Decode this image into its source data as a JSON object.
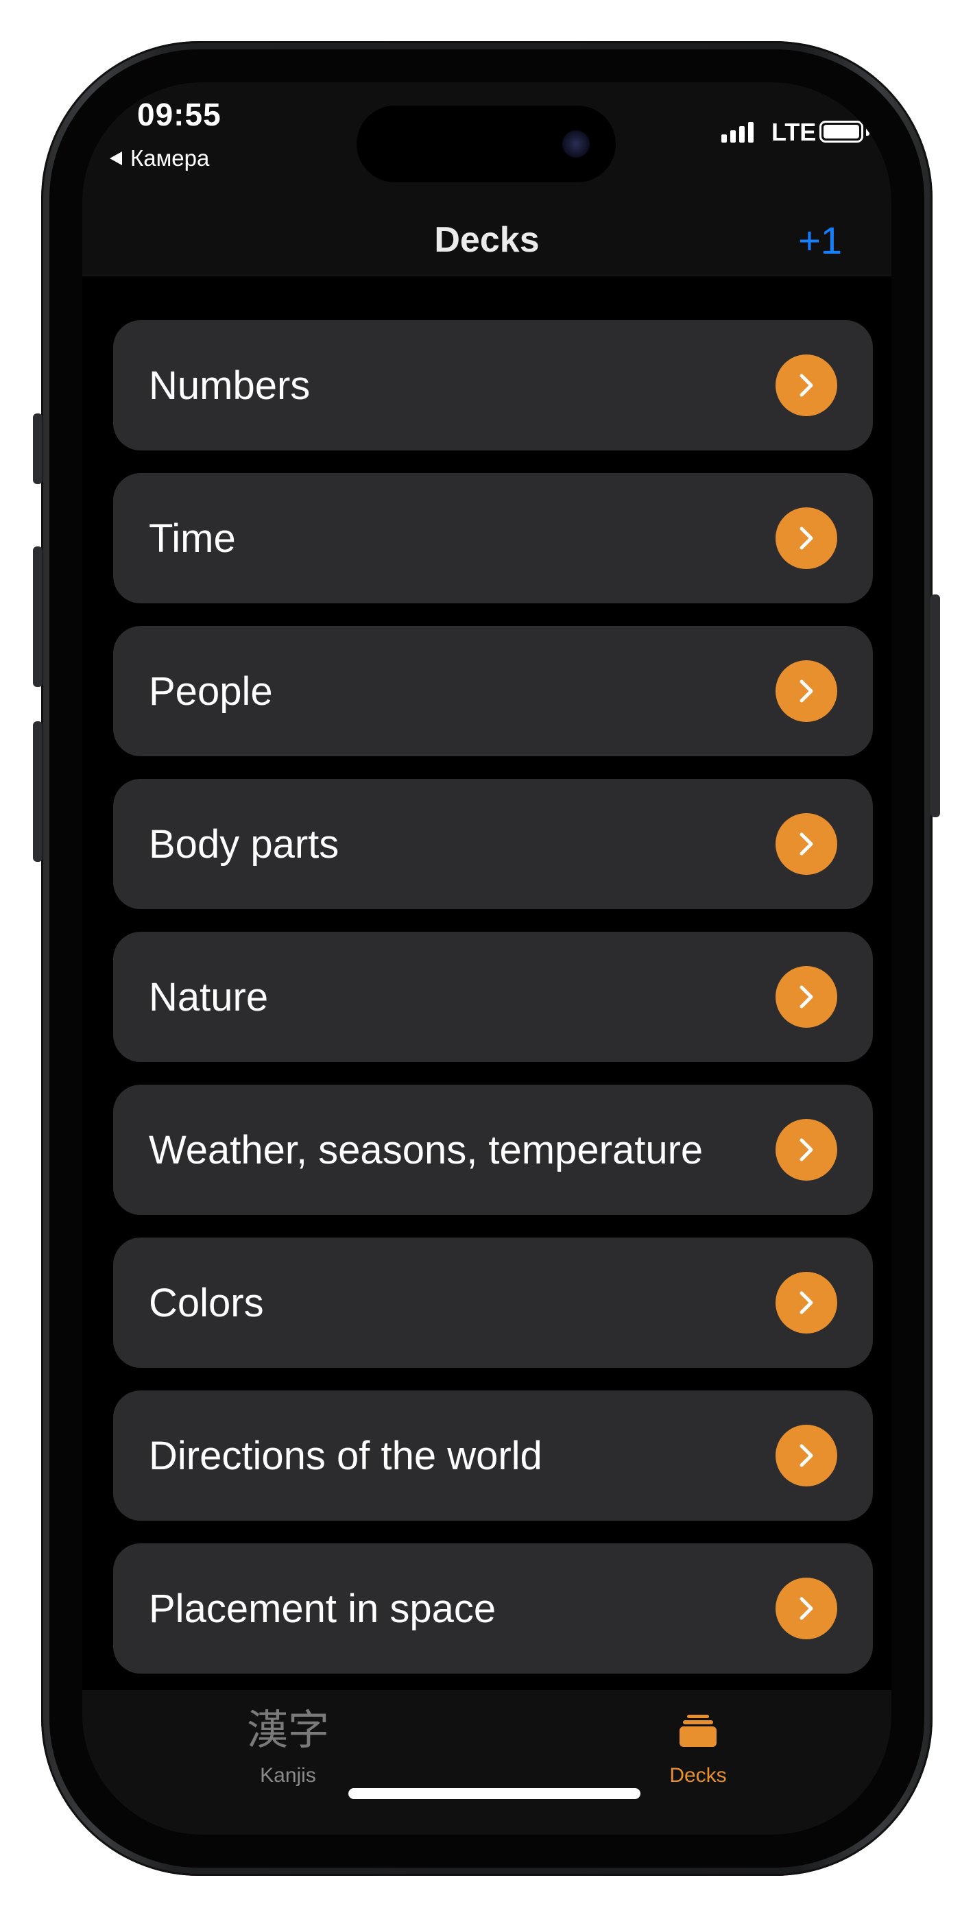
{
  "status_bar": {
    "time": "09:55",
    "back_label": "Камера",
    "network": "LTE"
  },
  "nav": {
    "title": "Decks",
    "action_label": "+1"
  },
  "decks": [
    {
      "label": "Numbers"
    },
    {
      "label": "Time"
    },
    {
      "label": "People"
    },
    {
      "label": "Body parts"
    },
    {
      "label": "Nature"
    },
    {
      "label": "Weather, seasons, temperature"
    },
    {
      "label": "Colors"
    },
    {
      "label": "Directions of the world"
    },
    {
      "label": "Placement in space"
    }
  ],
  "tab_bar": {
    "tabs": [
      {
        "label": "Kanjis",
        "icon_text": "漢字",
        "icon": "kanji-icon"
      },
      {
        "label": "Decks",
        "icon": "stack-icon",
        "selected": true
      }
    ]
  },
  "colors": {
    "accent": "#e88f2e",
    "link": "#1480ff",
    "card": "#2c2c2e",
    "background": "#000000"
  }
}
